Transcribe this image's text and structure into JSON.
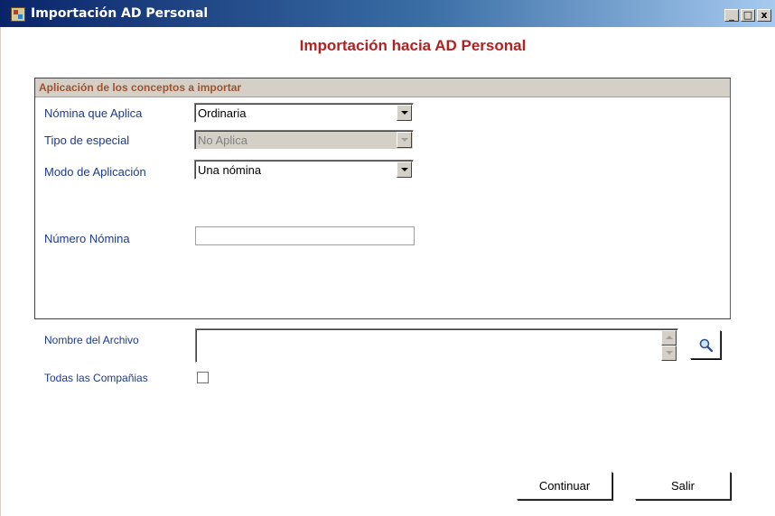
{
  "window": {
    "title": "Importación AD Personal",
    "controls": {
      "minimize": "_",
      "maximize": "□",
      "close": "x"
    }
  },
  "heading": "Importación hacia AD Personal",
  "group": {
    "title": "Aplicación de los conceptos a importar",
    "fields": {
      "nomina_que_aplica": {
        "label": "Nómina que Aplica",
        "value": "Ordinaria"
      },
      "tipo_de_especial": {
        "label": "Tipo de especial",
        "value": "No Aplica",
        "disabled": true
      },
      "modo_de_aplicacion": {
        "label": "Modo de Aplicación",
        "value": "Una nómina"
      },
      "numero_nomina": {
        "label": "Número Nómina",
        "value": ""
      }
    }
  },
  "file": {
    "label": "Nombre del Archivo",
    "value": "",
    "browse_icon": "magnifier-icon"
  },
  "all_companies": {
    "label": "Todas las Compañias",
    "checked": false
  },
  "buttons": {
    "continue": "Continuar",
    "exit": "Salir"
  },
  "colors": {
    "heading": "#b22222",
    "group_title": "#a0522d",
    "labels": "#1e3a8a",
    "titlebar_start": "#0a246a",
    "titlebar_end": "#a6caf0"
  }
}
